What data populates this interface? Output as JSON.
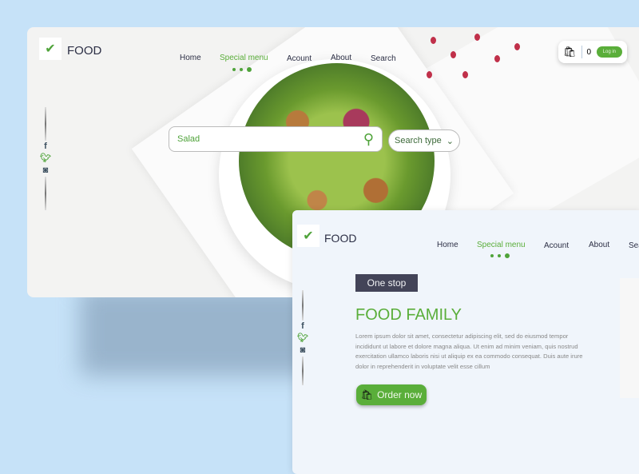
{
  "back_screen": {
    "brand": "FOOD",
    "nav": [
      {
        "label": "Home"
      },
      {
        "label": "Special menu",
        "active": true
      },
      {
        "label": "Acount"
      },
      {
        "label": "About"
      },
      {
        "label": "Search"
      }
    ],
    "search": {
      "value": "Salad",
      "type_label": "Search type"
    },
    "cart": {
      "count": "0",
      "login_label": "Log in"
    }
  },
  "front_screen": {
    "brand": "FOOD",
    "nav": [
      {
        "label": "Home"
      },
      {
        "label": "Special menu",
        "active": true
      },
      {
        "label": "Acount"
      },
      {
        "label": "About"
      },
      {
        "label": "Sea"
      }
    ],
    "badge": "One stop",
    "title": "FOOD FAMILY",
    "body": "Lorem ipsum dolor sit amet, consectetur adipiscing elit, sed do eiusmod tempor incididunt ut labore et dolore magna aliqua. Ut enim ad minim veniam, quis nostrud exercitation ullamco laboris nisi ut aliquip ex ea commodo consequat. Duis aute irure dolor in reprehenderit in voluptate velit esse cillum",
    "order_label": "Order now"
  },
  "colors": {
    "accent": "#5aae3a",
    "dark": "#434458",
    "background": "#c6e2f8"
  }
}
